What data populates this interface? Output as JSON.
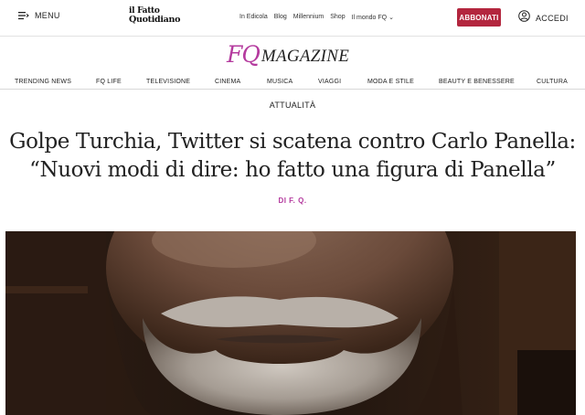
{
  "header": {
    "menu_label": "MENU",
    "logo_line1": "il Fatto",
    "logo_line2": "Quotidiano",
    "top_links": [
      "In Edicola",
      "Blog",
      "Millennium",
      "Shop",
      "Il mondo FQ"
    ],
    "subscribe_label": "ABBONATI",
    "login_label": "ACCEDI"
  },
  "magazine": {
    "logo_fq": "FQ",
    "logo_word": "MAGAZINE"
  },
  "sections": [
    "TRENDING NEWS",
    "FQ LIFE",
    "TELEVISIONE",
    "CINEMA",
    "MUSICA",
    "VIAGGI",
    "MODA E STILE",
    "BEAUTY E BENESSERE",
    "CULTURA"
  ],
  "article": {
    "category": "ATTUALITÀ",
    "title_line1": "Golpe Turchia, Twitter si scatena contro Carlo Panella:",
    "title_line2": "“Nuovi modi di dire: ho fatto una figura di Panella”",
    "byline": "DI F. Q."
  },
  "colors": {
    "brand_magenta": "#b43a9e",
    "subscribe_red": "#b3263e"
  }
}
